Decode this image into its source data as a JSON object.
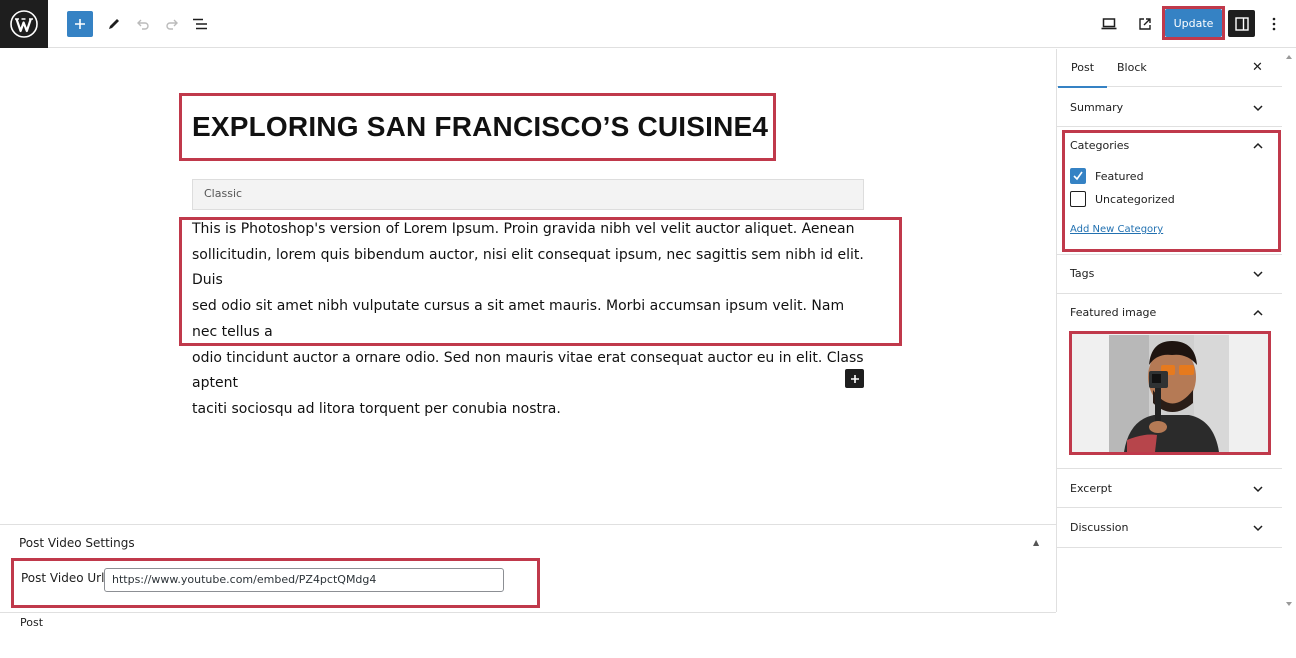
{
  "toolbar": {
    "add_block_icon": "plus-icon",
    "tools_icon": "pencil-icon",
    "undo_icon": "undo-icon",
    "redo_icon": "redo-icon",
    "list_view_icon": "list-view-icon",
    "preview_icon": "desktop-icon",
    "view_post_icon": "external-link-icon",
    "update_label": "Update",
    "settings_icon": "sidebar-icon",
    "options_icon": "kebab-icon"
  },
  "editor": {
    "title": "EXPLORING SAN FRANCISCO’S CUISINE4",
    "classic_label": "Classic",
    "paragraph_lines": [
      "This is Photoshop's version of Lorem Ipsum. Proin gravida nibh vel velit auctor aliquet. Aenean",
      "sollicitudin, lorem quis bibendum auctor, nisi elit consequat ipsum, nec sagittis sem nibh id elit. Duis",
      "sed odio sit amet nibh vulputate cursus a sit amet mauris. Morbi accumsan ipsum velit. Nam nec tellus a",
      "odio tincidunt auctor a ornare odio. Sed non mauris vitae erat consequat auctor eu in elit. Class aptent",
      "taciti sociosqu ad litora torquent per conubia nostra."
    ]
  },
  "meta_box": {
    "title": "Post Video Settings",
    "field_label": "Post Video Url",
    "field_value": "https://www.youtube.com/embed/PZ4pctQMdg4"
  },
  "footer": {
    "breadcrumb": "Post"
  },
  "sidebar": {
    "tabs": [
      "Post",
      "Block"
    ],
    "sections": {
      "summary": "Summary",
      "categories": "Categories",
      "tags": "Tags",
      "featured_image": "Featured image",
      "excerpt": "Excerpt",
      "discussion": "Discussion"
    },
    "categories": [
      {
        "label": "Featured",
        "checked": true
      },
      {
        "label": "Uncategorized",
        "checked": false
      }
    ],
    "add_category": "Add New Category"
  },
  "colors": {
    "accent": "#3582c4",
    "highlight": "#c0394b",
    "dark": "#1e1e1e"
  }
}
